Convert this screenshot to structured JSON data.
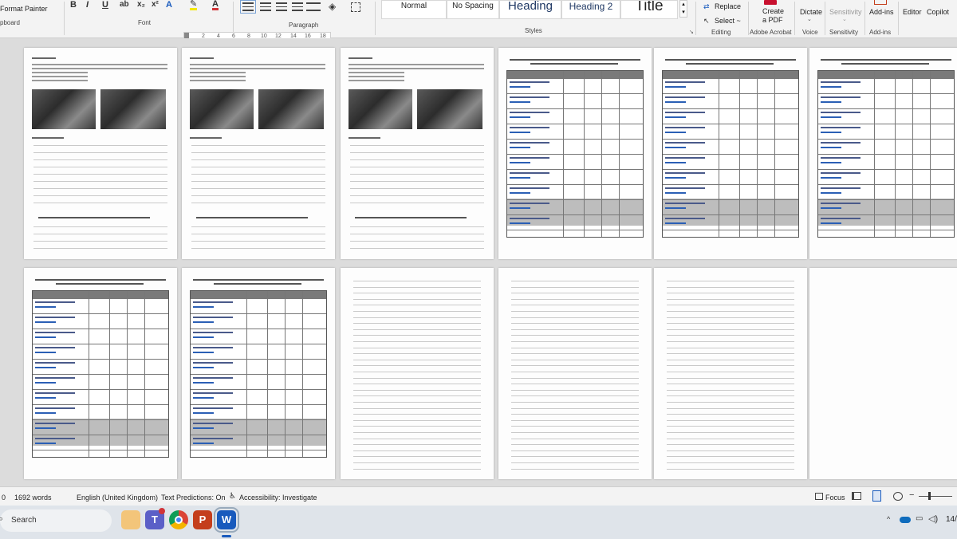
{
  "ribbon": {
    "clipboard": {
      "format_painter": "Format Painter",
      "group_label": "pboard"
    },
    "font": {
      "group_label": "Font"
    },
    "paragraph": {
      "group_label": "Paragraph"
    },
    "styles": {
      "group_label": "Styles",
      "items": [
        "Normal",
        "No Spacing",
        "Heading",
        "Heading 2",
        "Title"
      ]
    },
    "editing": {
      "replace": "Replace",
      "select": "Select ~",
      "group_label": "Editing"
    },
    "adobe": {
      "create_pdf_line1": "Create",
      "create_pdf_line2": "a PDF",
      "group_label": "Adobe Acrobat"
    },
    "voice": {
      "dictate": "Dictate",
      "group_label": "Voice"
    },
    "sensitivity": {
      "label": "Sensitivity",
      "group_label": "Sensitivity"
    },
    "addins": {
      "label": "Add-ins",
      "group_label": "Add-ins"
    },
    "editor": {
      "label": "Editor"
    },
    "copilot": {
      "label": "Copilot"
    },
    "formatting_glyphs": [
      "B",
      "I",
      "U",
      "x₂",
      "x²",
      "A",
      "A"
    ]
  },
  "ruler": {
    "ticks": [
      "2",
      "4",
      "6",
      "8",
      "10",
      "12",
      "14",
      "16",
      "18"
    ]
  },
  "status_bar": {
    "page_indicator": "0",
    "word_count": "1692 words",
    "language": "English (United Kingdom)",
    "text_predictions": "Text Predictions: On",
    "accessibility": "Accessibility: Investigate",
    "focus": "Focus"
  },
  "taskbar": {
    "search_placeholder": "Search",
    "apps": [
      "file-explorer-icon",
      "teams-icon",
      "chrome-icon",
      "powerpoint-icon",
      "word-icon"
    ],
    "clock_partial": "14/"
  },
  "colors": {
    "ribbon_bg": "#f3f3f3",
    "canvas_bg": "#dcdcdc",
    "word_blue": "#185abd",
    "ppt_orange": "#c43e1c"
  }
}
